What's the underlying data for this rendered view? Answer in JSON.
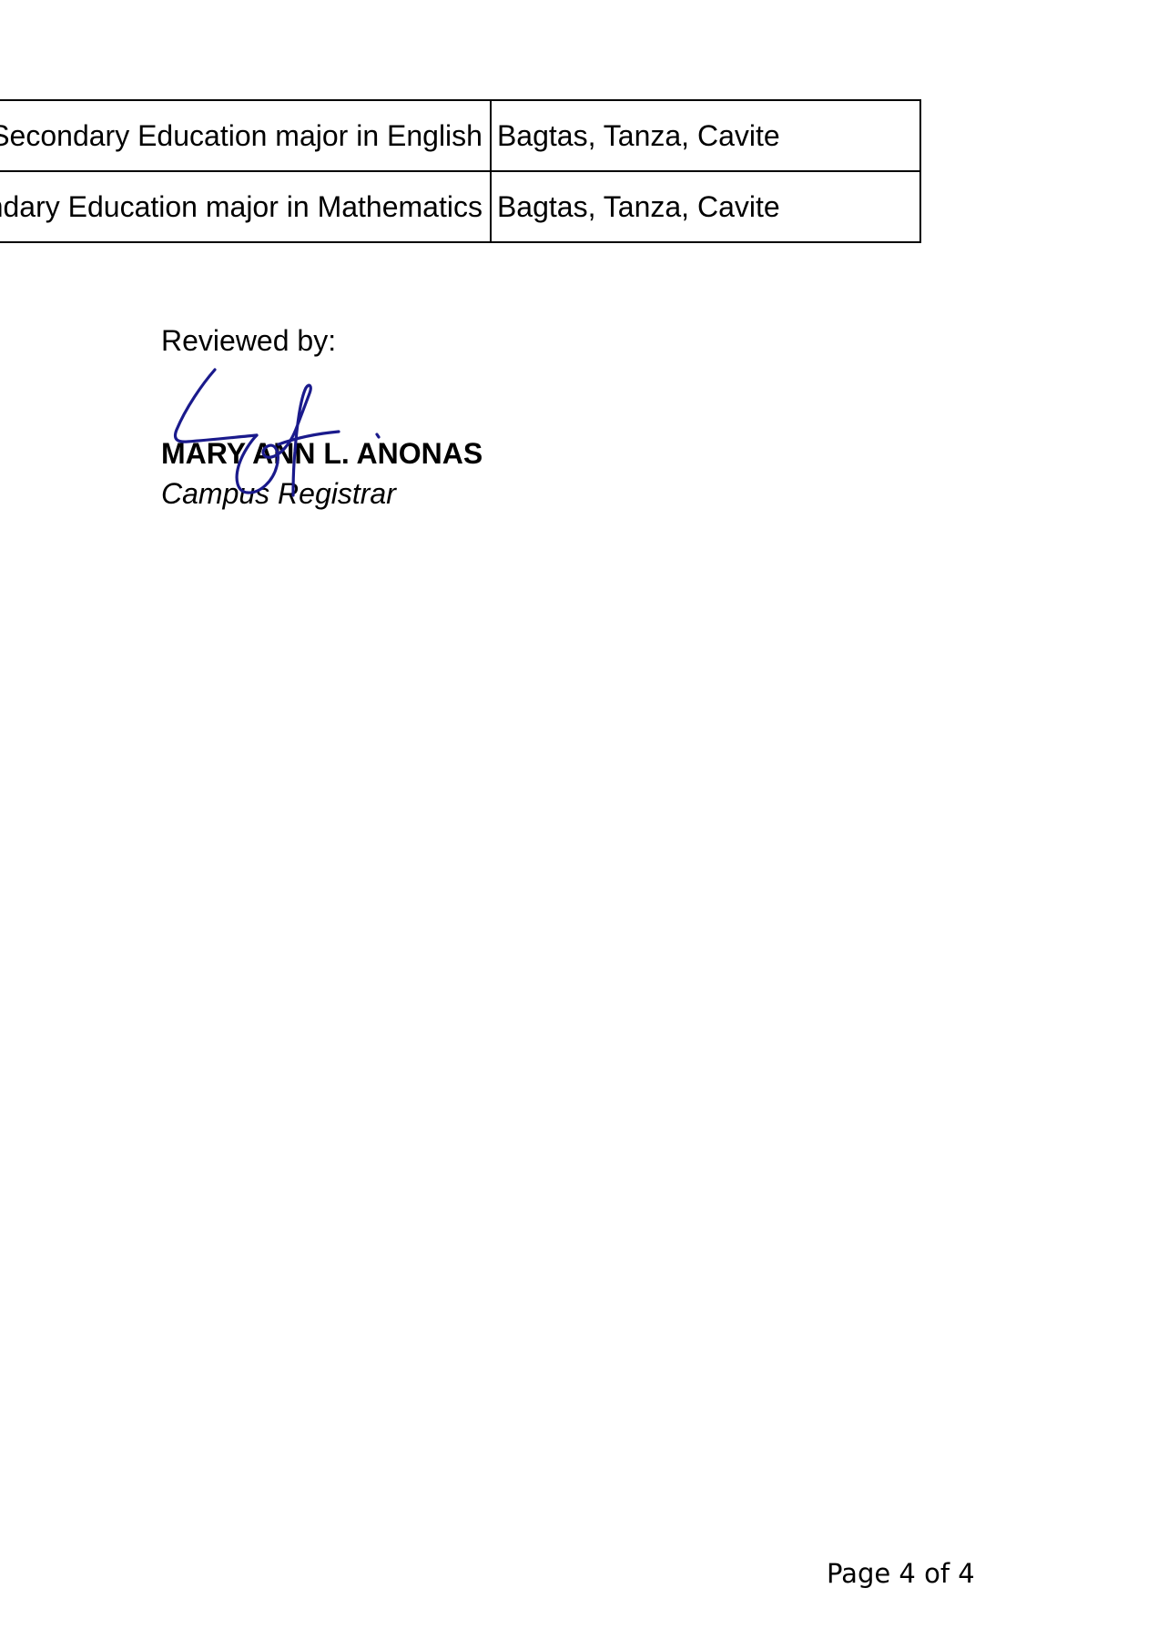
{
  "table": {
    "rows": [
      {
        "program": "Bachelor of Secondary Education major in English",
        "address": "Bagtas, Tanza, Cavite"
      },
      {
        "program": "Bachelor of Secondary Education major in Mathematics",
        "address": "Bagtas, Tanza, Cavite"
      }
    ]
  },
  "review": {
    "label": "Reviewed by:",
    "name": "MARY ANN L. ANONAS",
    "title": "Campus Registrar",
    "signature_color": "#1a1a8c"
  },
  "footer": {
    "page": "Page 4 of 4"
  }
}
